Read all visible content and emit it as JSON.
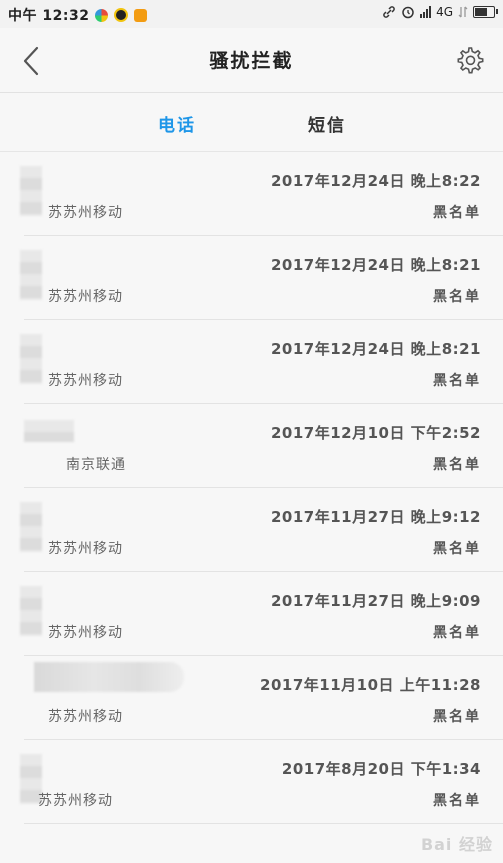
{
  "status_bar": {
    "time": "中午 12:32",
    "network": "4G"
  },
  "header": {
    "title": "骚扰拦截"
  },
  "tabs": [
    {
      "label": "电话",
      "active": true
    },
    {
      "label": "短信",
      "active": false
    }
  ],
  "calls": [
    {
      "time": "2017年12月24日 晚上8:22",
      "carrier": "苏苏州移动",
      "tag": "黑名单"
    },
    {
      "time": "2017年12月24日 晚上8:21",
      "carrier": "苏苏州移动",
      "tag": "黑名单"
    },
    {
      "time": "2017年12月24日 晚上8:21",
      "carrier": "苏苏州移动",
      "tag": "黑名单"
    },
    {
      "time": "2017年12月10日 下午2:52",
      "carrier": "南京联通",
      "tag": "黑名单"
    },
    {
      "time": "2017年11月27日 晚上9:12",
      "carrier": "苏苏州移动",
      "tag": "黑名单"
    },
    {
      "time": "2017年11月27日 晚上9:09",
      "carrier": "苏苏州移动",
      "tag": "黑名单"
    },
    {
      "time": "2017年11月10日 上午11:28",
      "carrier": "苏苏州移动",
      "tag": "黑名单"
    },
    {
      "time": "2017年8月20日 下午1:34",
      "carrier": "苏苏州移动",
      "tag": "黑名单"
    }
  ],
  "watermark": "Bai 经验",
  "colors": {
    "accent": "#1e96e8",
    "background": "#f7f7f7"
  }
}
